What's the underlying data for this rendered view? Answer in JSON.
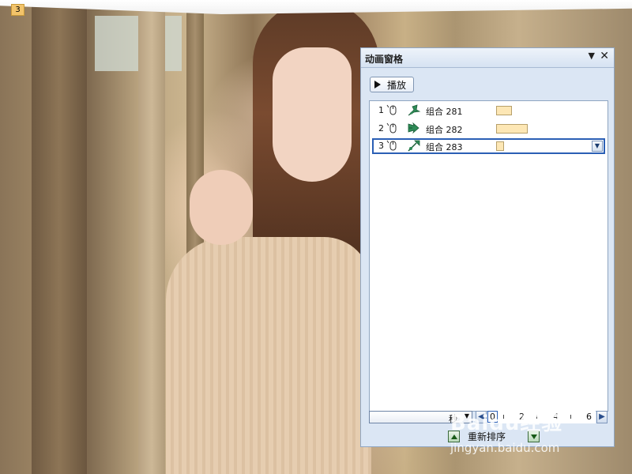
{
  "slide": {
    "badge": "3"
  },
  "pane": {
    "title": "动画窗格",
    "menu_glyph": "▼",
    "close_glyph": "✕",
    "play_label": "播放",
    "items": [
      {
        "order": "1",
        "label": "组合 281",
        "bar_color": "#fde7b5",
        "selected": false
      },
      {
        "order": "2",
        "label": "组合 282",
        "bar_color": "#fde7b5",
        "selected": false
      },
      {
        "order": "3",
        "label": "组合 283",
        "bar_color": "#fde7b5",
        "selected": true
      }
    ],
    "timeline": {
      "unit_label": "秒",
      "ticks": [
        "0",
        "2",
        "4",
        "6"
      ],
      "current_tick": "0"
    },
    "reorder_label": "重新排序"
  },
  "watermark": {
    "brand": "Baidu经验",
    "url": "jingyan.baidu.com"
  },
  "colors": {
    "selection": "#2b5fb5",
    "pane_bg": "#dbe6f4",
    "timing_bar": "#fde7b5"
  }
}
